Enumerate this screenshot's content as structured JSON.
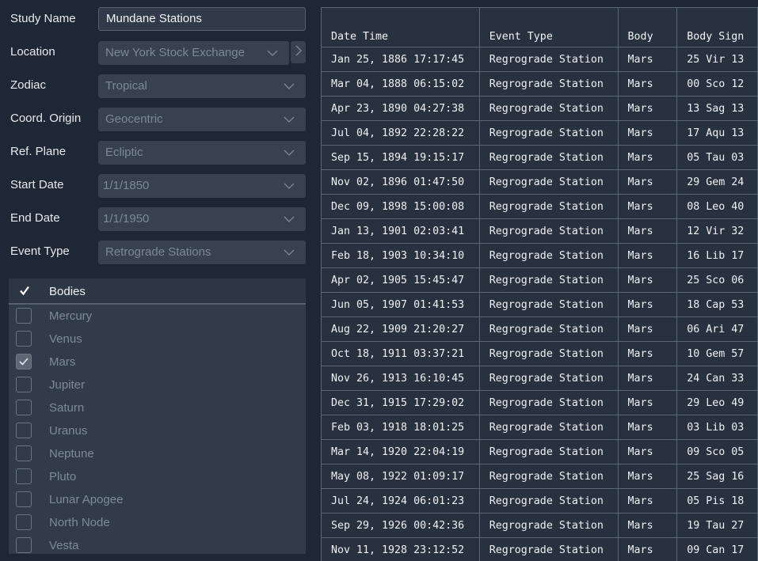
{
  "form": {
    "study_name": {
      "label": "Study Name",
      "value": "Mundane Stations"
    },
    "location": {
      "label": "Location",
      "value": "New York Stock Exchange"
    },
    "zodiac": {
      "label": "Zodiac",
      "value": "Tropical"
    },
    "coord_origin": {
      "label": "Coord. Origin",
      "value": "Geocentric"
    },
    "ref_plane": {
      "label": "Ref. Plane",
      "value": "Ecliptic"
    },
    "start_date": {
      "label": "Start Date",
      "value": "1/1/1850"
    },
    "end_date": {
      "label": "End Date",
      "value": "1/1/1950"
    },
    "event_type": {
      "label": "Event Type",
      "value": "Retrograde Stations"
    }
  },
  "bodies": {
    "header": "Bodies",
    "items": [
      {
        "label": "Mercury",
        "checked": false
      },
      {
        "label": "Venus",
        "checked": false
      },
      {
        "label": "Mars",
        "checked": true
      },
      {
        "label": "Jupiter",
        "checked": false
      },
      {
        "label": "Saturn",
        "checked": false
      },
      {
        "label": "Uranus",
        "checked": false
      },
      {
        "label": "Neptune",
        "checked": false
      },
      {
        "label": "Pluto",
        "checked": false
      },
      {
        "label": "Lunar Apogee",
        "checked": false
      },
      {
        "label": "North Node",
        "checked": false
      },
      {
        "label": "Vesta",
        "checked": false
      }
    ]
  },
  "table": {
    "columns": [
      "Date Time",
      "Event Type",
      "Body",
      "Body Sign"
    ],
    "rows": [
      [
        "Jan 25, 1886 17:17:45",
        "Regrograde Station",
        "Mars",
        "25 Vir 13"
      ],
      [
        "Mar 04, 1888 06:15:02",
        "Regrograde Station",
        "Mars",
        "00 Sco 12"
      ],
      [
        "Apr 23, 1890 04:27:38",
        "Regrograde Station",
        "Mars",
        "13 Sag 13"
      ],
      [
        "Jul 04, 1892 22:28:22",
        "Regrograde Station",
        "Mars",
        "17 Aqu 13"
      ],
      [
        "Sep 15, 1894 19:15:17",
        "Regrograde Station",
        "Mars",
        "05 Tau 03"
      ],
      [
        "Nov 02, 1896 01:47:50",
        "Regrograde Station",
        "Mars",
        "29 Gem 24"
      ],
      [
        "Dec 09, 1898 15:00:08",
        "Regrograde Station",
        "Mars",
        "08 Leo 40"
      ],
      [
        "Jan 13, 1901 02:03:41",
        "Regrograde Station",
        "Mars",
        "12 Vir 32"
      ],
      [
        "Feb 18, 1903 10:34:10",
        "Regrograde Station",
        "Mars",
        "16 Lib 17"
      ],
      [
        "Apr 02, 1905 15:45:47",
        "Regrograde Station",
        "Mars",
        "25 Sco 06"
      ],
      [
        "Jun 05, 1907 01:41:53",
        "Regrograde Station",
        "Mars",
        "18 Cap 53"
      ],
      [
        "Aug 22, 1909 21:20:27",
        "Regrograde Station",
        "Mars",
        "06 Ari 47"
      ],
      [
        "Oct 18, 1911 03:37:21",
        "Regrograde Station",
        "Mars",
        "10 Gem 57"
      ],
      [
        "Nov 26, 1913 16:10:45",
        "Regrograde Station",
        "Mars",
        "24 Can 33"
      ],
      [
        "Dec 31, 1915 17:29:02",
        "Regrograde Station",
        "Mars",
        "29 Leo 49"
      ],
      [
        "Feb 03, 1918 18:01:25",
        "Regrograde Station",
        "Mars",
        "03 Lib 03"
      ],
      [
        "Mar 14, 1920 22:04:19",
        "Regrograde Station",
        "Mars",
        "09 Sco 05"
      ],
      [
        "May 08, 1922 01:09:17",
        "Regrograde Station",
        "Mars",
        "25 Sag 16"
      ],
      [
        "Jul 24, 1924 06:01:23",
        "Regrograde Station",
        "Mars",
        "05 Pis 18"
      ],
      [
        "Sep 29, 1926 00:42:36",
        "Regrograde Station",
        "Mars",
        "19 Tau 27"
      ],
      [
        "Nov 11, 1928 23:12:52",
        "Regrograde Station",
        "Mars",
        "09 Can 17"
      ]
    ]
  },
  "icons": {
    "dropdown": "chevron-down-icon",
    "side_button": "chevron-right-icon",
    "check": "check-icon"
  }
}
